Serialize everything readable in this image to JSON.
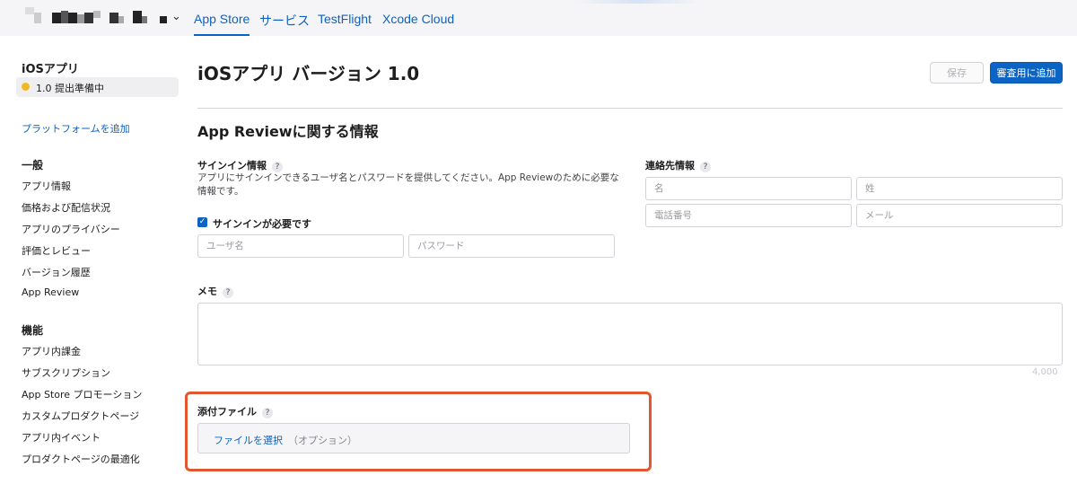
{
  "topbar": {
    "tabs": [
      {
        "label": "App Store",
        "active": true
      },
      {
        "label": "サービス",
        "active": false
      },
      {
        "label": "TestFlight",
        "active": false
      },
      {
        "label": "Xcode Cloud",
        "active": false
      }
    ]
  },
  "sidebar": {
    "app_title": "iOSアプリ",
    "version_label": "1.0 提出準備中",
    "add_platform": "プラットフォームを追加",
    "sections": [
      {
        "heading": "一般",
        "items": [
          "アプリ情報",
          "価格および配信状況",
          "アプリのプライバシー",
          "評価とレビュー",
          "バージョン履歴",
          "App Review"
        ]
      },
      {
        "heading": "機能",
        "items": [
          "アプリ内課金",
          "サブスクリプション",
          "App Store プロモーション",
          "カスタムプロダクトページ",
          "アプリ内イベント",
          "プロダクトページの最適化"
        ]
      }
    ]
  },
  "main": {
    "title": "iOSアプリ バージョン 1.0",
    "save_label": "保存",
    "submit_label": "審査用に追加",
    "section_title": "App Reviewに関する情報",
    "signin": {
      "label": "サインイン情報",
      "description": "アプリにサインインできるユーザ名とパスワードを提供してください。App Reviewのために必要な情報です。",
      "checkbox_label": "サインインが必要です",
      "username_placeholder": "ユーザ名",
      "password_placeholder": "パスワード"
    },
    "contact": {
      "label": "連絡先情報",
      "first_name_placeholder": "名",
      "last_name_placeholder": "姓",
      "phone_placeholder": "電話番号",
      "email_placeholder": "メール"
    },
    "memo": {
      "label": "メモ",
      "counter": "4,000"
    },
    "attachment": {
      "label": "添付ファイル",
      "choose_file": "ファイルを選択",
      "optional": "（オプション）"
    },
    "help_glyph": "?"
  },
  "colors": {
    "accent": "#0b63c4",
    "highlight": "#e2572f",
    "status_dot": "#f2b824"
  }
}
